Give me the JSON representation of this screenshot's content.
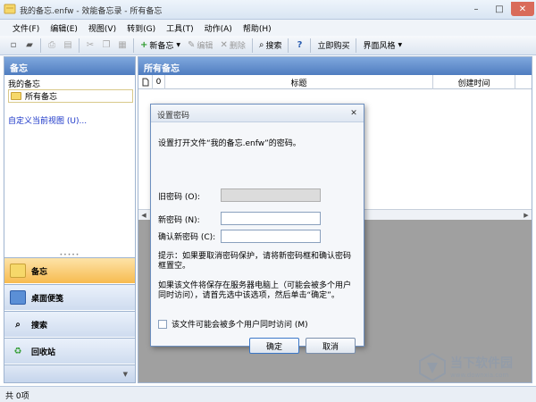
{
  "window": {
    "title": "我的备忘.enfw - 效能备忘录 - 所有备忘",
    "min": "–",
    "max": "□",
    "close": "✕"
  },
  "menu": [
    "文件(F)",
    "编辑(E)",
    "视图(V)",
    "转到(G)",
    "工具(T)",
    "动作(A)",
    "帮助(H)"
  ],
  "toolbar": {
    "new_memo": "新备忘",
    "edit": "编辑",
    "delete": "删除",
    "search": "搜索",
    "buy_now": "立即购买",
    "ui_style": "界面风格"
  },
  "left": {
    "header": "备忘",
    "root": "我的备忘",
    "folder": "所有备忘",
    "custom_view": "自定义当前视图 (U)..."
  },
  "nav": {
    "notes": "备忘",
    "desktop": "桌面便笺",
    "search": "搜索",
    "recycle": "回收站"
  },
  "right": {
    "header": "所有备忘",
    "columns": [
      "",
      "",
      "标题",
      "创建时间"
    ]
  },
  "status": "共 0项",
  "dialog": {
    "title": "设置密码",
    "intro": "设置打开文件“我的备忘.enfw”的密码。",
    "old_label": "旧密码 (O):",
    "new_label": "新密码 (N):",
    "confirm_label": "确认新密码 (C):",
    "tip": "提示：如果要取消密码保护，请将新密码框和确认密码框置空。",
    "server_note": "如果该文件将保存在服务器电脑上（可能会被多个用户同时访问），请首先选中该选项，然后单击“确定”。",
    "checkbox_label": "该文件可能会被多个用户同时访问 (M)",
    "multiuser_checked": false,
    "ok": "确定",
    "cancel": "取消"
  },
  "watermark": {
    "text": "当下软件园",
    "url": "www.downxia.com"
  }
}
